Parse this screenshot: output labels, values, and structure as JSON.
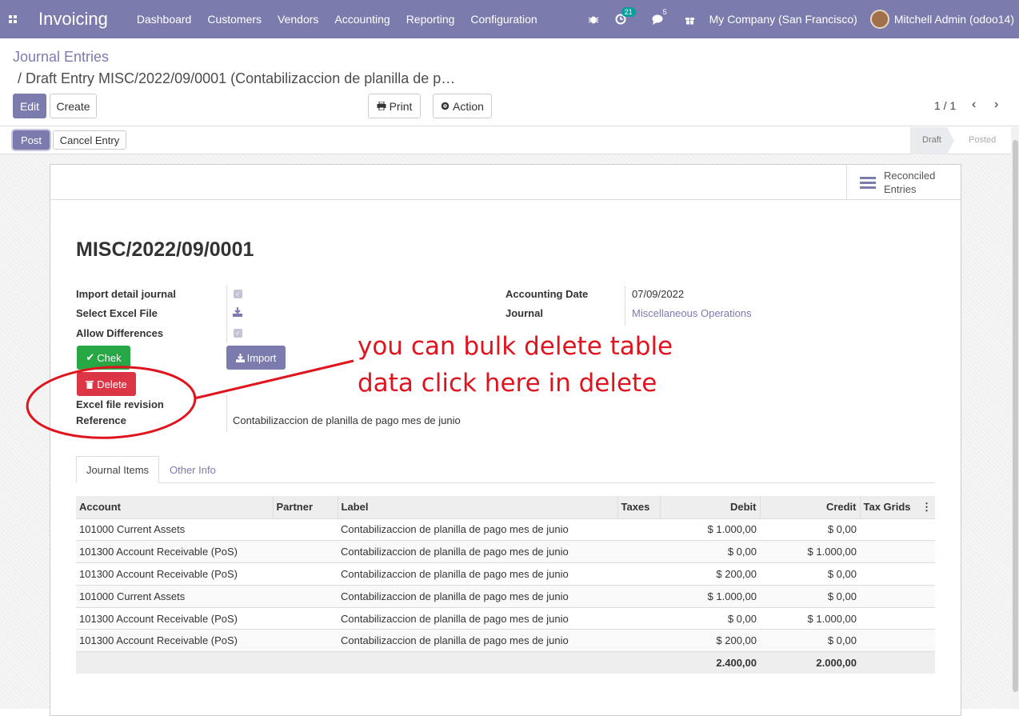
{
  "navbar": {
    "app_name": "Invoicing",
    "menu": [
      "Dashboard",
      "Customers",
      "Vendors",
      "Accounting",
      "Reporting",
      "Configuration"
    ],
    "activities_count": "21",
    "messages_count": "5",
    "company": "My Company (San Francisco)",
    "user": "Mitchell Admin (odoo14)"
  },
  "breadcrumb": {
    "parent": "Journal Entries",
    "current": "/ Draft Entry MISC/2022/09/0001 (Contabilizaccion de planilla de p…"
  },
  "toolbar": {
    "edit": "Edit",
    "create": "Create",
    "print": "Print",
    "action": "Action",
    "pager": "1 / 1"
  },
  "statusbar": {
    "post": "Post",
    "cancel": "Cancel Entry",
    "stages": [
      "Draft",
      "Posted"
    ]
  },
  "button_box": {
    "reconciled": "Reconciled Entries"
  },
  "form": {
    "title": "MISC/2022/09/0001",
    "import_detail_journal": "Import detail journal",
    "select_excel_file": "Select Excel File",
    "allow_differences": "Allow Differences",
    "chek_button": "Chek",
    "import_button": "Import",
    "delete_button": "Delete",
    "excel_file_revision": "Excel file revision",
    "reference_label": "Reference",
    "reference_value": "Contabilizaccion de planilla de pago mes de junio",
    "accounting_date_label": "Accounting Date",
    "accounting_date_value": "07/09/2022",
    "journal_label": "Journal",
    "journal_value": "Miscellaneous Operations"
  },
  "annotation": {
    "line1": "you can bulk delete table",
    "line2": "data click here in delete",
    "color": "#e0141e"
  },
  "tabs": [
    "Journal Items",
    "Other Info"
  ],
  "table": {
    "headers": [
      "Account",
      "Partner",
      "Label",
      "Taxes",
      "Debit",
      "Credit",
      "Tax Grids"
    ],
    "rows": [
      [
        "101000 Current Assets",
        "",
        "Contabilizaccion de planilla de pago mes de junio",
        "",
        "$ 1.000,00",
        "$ 0,00",
        ""
      ],
      [
        "101300 Account Receivable (PoS)",
        "",
        "Contabilizaccion de planilla de pago mes de junio",
        "",
        "$ 0,00",
        "$ 1.000,00",
        ""
      ],
      [
        "101300 Account Receivable (PoS)",
        "",
        "Contabilizaccion de planilla de pago mes de junio",
        "",
        "$ 200,00",
        "$ 0,00",
        ""
      ],
      [
        "101000 Current Assets",
        "",
        "Contabilizaccion de planilla de pago mes de junio",
        "",
        "$ 1.000,00",
        "$ 0,00",
        ""
      ],
      [
        "101300 Account Receivable (PoS)",
        "",
        "Contabilizaccion de planilla de pago mes de junio",
        "",
        "$ 0,00",
        "$ 1.000,00",
        ""
      ],
      [
        "101300 Account Receivable (PoS)",
        "",
        "Contabilizaccion de planilla de pago mes de junio",
        "",
        "$ 200,00",
        "$ 0,00",
        ""
      ]
    ],
    "totals": {
      "debit": "2.400,00",
      "credit": "2.000,00"
    }
  },
  "colors": {
    "brand": "#7c7bad",
    "success": "#28a745",
    "danger": "#dc3545"
  }
}
